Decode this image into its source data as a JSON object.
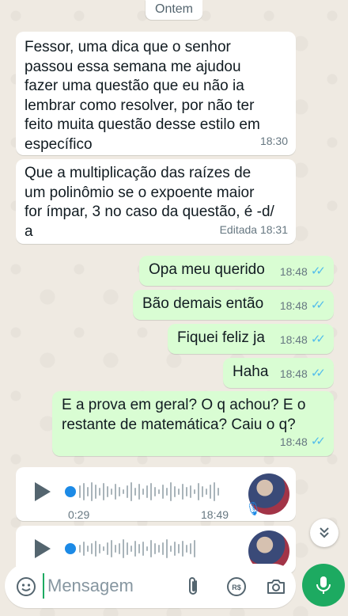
{
  "date_divider": "Ontem",
  "messages": [
    {
      "text": "Fessor, uma dica que o senhor\npassou essa semana me ajudou\nfazer uma questão que eu não ia\nlembrar como resolver, por não ter\nfeito muita questão desse estilo em\nespecífico",
      "time": "18:30"
    },
    {
      "text": "Que a multiplicação das raízes de\num polinômio se o expoente maior\nfor ímpar, 3 no caso da questão, é -d/\na",
      "time": "Editada 18:31"
    },
    {
      "text": "Opa meu querido",
      "time": "18:48"
    },
    {
      "text": "Bão demais então",
      "time": "18:48"
    },
    {
      "text": "Fiquei feliz ja",
      "time": "18:48"
    },
    {
      "text": "Haha",
      "time": "18:48"
    },
    {
      "text": "E a prova em geral? O q achou? E o\nrestante de matemática? Caiu o q?",
      "time": "18:48"
    }
  ],
  "voice_notes": [
    {
      "duration": "0:29",
      "time": "18:49"
    },
    {
      "duration": "",
      "time": ""
    }
  ],
  "composer": {
    "placeholder": "Mensagem"
  },
  "colors": {
    "incoming": "#ffffff",
    "outgoing": "#d9fdd3",
    "accent": "#1daa61",
    "read_ticks": "#53bdeb"
  }
}
